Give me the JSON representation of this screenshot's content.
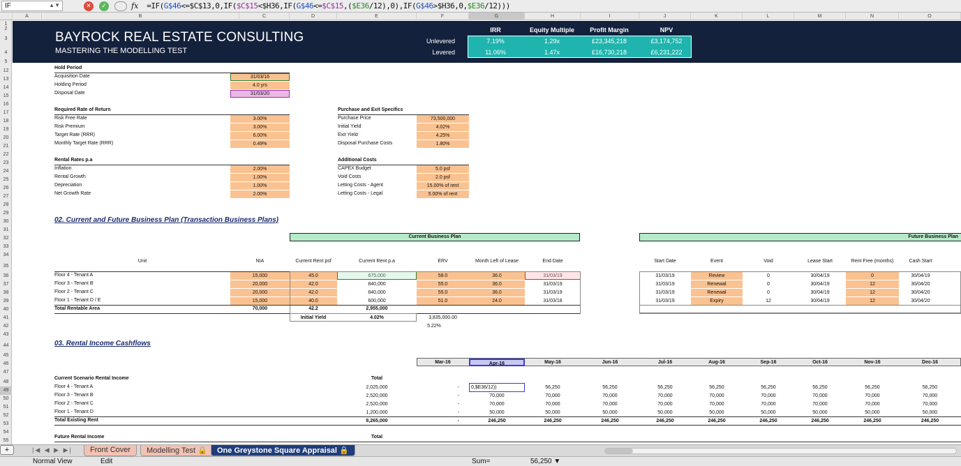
{
  "formula_bar": {
    "name_box": "IF",
    "formula_parts": [
      {
        "t": "=IF(",
        "c": ""
      },
      {
        "t": "G$46",
        "c": "blue"
      },
      {
        "t": "<=",
        "c": ""
      },
      {
        "t": "$C$13",
        "c": ""
      },
      {
        "t": ",0,IF(",
        "c": ""
      },
      {
        "t": "$C$15",
        "c": "purple"
      },
      {
        "t": "<",
        "c": ""
      },
      {
        "t": "$H36",
        "c": ""
      },
      {
        "t": ",IF(",
        "c": ""
      },
      {
        "t": "G$46",
        "c": "blue"
      },
      {
        "t": "<=",
        "c": ""
      },
      {
        "t": "$C$15",
        "c": "purple"
      },
      {
        "t": ",(",
        "c": ""
      },
      {
        "t": "$E36",
        "c": "green"
      },
      {
        "t": "/12),0),IF(",
        "c": ""
      },
      {
        "t": "G$46",
        "c": "blue"
      },
      {
        "t": ">",
        "c": ""
      },
      {
        "t": "$H36",
        "c": ""
      },
      {
        "t": ",0,",
        "c": ""
      },
      {
        "t": "$E36",
        "c": "green"
      },
      {
        "t": "/12)))",
        "c": ""
      }
    ]
  },
  "columns": [
    "A",
    "B",
    "C",
    "D",
    "E",
    "F",
    "G",
    "H",
    "I",
    "J",
    "K",
    "L",
    "M",
    "N",
    "O"
  ],
  "rows": [
    "1",
    "2",
    "3",
    "4",
    "5",
    "12",
    "13",
    "14",
    "15",
    "16",
    "17",
    "18",
    "19",
    "20",
    "21",
    "22",
    "23",
    "24",
    "25",
    "26",
    "27",
    "28",
    "29",
    "30",
    "31",
    "32",
    "33",
    "34",
    "35",
    "36",
    "37",
    "38",
    "39",
    "40",
    "41",
    "42",
    "43",
    "44",
    "45",
    "46",
    "47",
    "48",
    "49",
    "50",
    "51",
    "52",
    "53",
    "54",
    "55"
  ],
  "banner": {
    "title": "BAYROCK REAL ESTATE CONSULTING",
    "subtitle": "MASTERING THE MODELLING TEST",
    "metric_headers": [
      "IRR",
      "Equity Multiple",
      "Profit Margin",
      "NPV"
    ],
    "rows": [
      {
        "label": "Unlevered",
        "values": [
          "7.19%",
          "1.29x",
          "£23,345,218",
          "£3,174,752"
        ]
      },
      {
        "label": "Levered",
        "values": [
          "11.06%",
          "1.47x",
          "£16,730,218",
          "£6,231,222"
        ]
      }
    ]
  },
  "hold_period": {
    "header": "Hold Period",
    "items": [
      {
        "label": "Acquisition Date",
        "value": "31/03/16"
      },
      {
        "label": "Holding Period",
        "value": "4.0 yrs"
      },
      {
        "label": "Disposal Date",
        "value": "31/03/20"
      }
    ]
  },
  "required_return": {
    "header": "Required Rate of Return",
    "items": [
      {
        "label": "Risk Free Rate",
        "value": "3.00%"
      },
      {
        "label": "Risk Premium",
        "value": "3.00%"
      },
      {
        "label": "Target Rate (RRR)",
        "value": "6.00%"
      },
      {
        "label": "Monthly Target Rate (RRR)",
        "value": "0.49%"
      }
    ]
  },
  "rental_rates": {
    "header": "Rental Rates p.a",
    "items": [
      {
        "label": "Inflation",
        "value": "2.00%"
      },
      {
        "label": "Rental Growth",
        "value": "1.00%"
      },
      {
        "label": "Depreciation",
        "value": "1.00%"
      },
      {
        "label": "Net Growth Rate",
        "value": "2.00%"
      }
    ]
  },
  "purchase_exit": {
    "header": "Purchase and Exit Specifics",
    "items": [
      {
        "label": "Purchase Price",
        "value": "73,500,000"
      },
      {
        "label": "Initial Yield",
        "value": "4.02%"
      },
      {
        "label": "Exit Yield",
        "value": "4.25%"
      },
      {
        "label": "Disposal Purchase Costs",
        "value": "1.80%"
      }
    ]
  },
  "additional_costs": {
    "header": "Additional Costs",
    "items": [
      {
        "label": "CAPEX Budget",
        "value": "5.0 psf"
      },
      {
        "label": "Void Costs",
        "value": "2.0 psf"
      },
      {
        "label": "Letting Costs - Agent",
        "value": "15.00% of rent"
      },
      {
        "label": "Letting Costs - Legal",
        "value": "5.00% of rent"
      }
    ]
  },
  "section2": {
    "title": "02. Current and Future Business Plan (Transaction Business Plans)",
    "current_plan_label": "Current Business Plan",
    "future_plan_label": "Future Business Plan",
    "headers": [
      "Unit",
      "NIA",
      "Current Rent psf",
      "Current Rent p.a",
      "ERV",
      "Month Left of Lease",
      "End Date",
      "Start Date",
      "Event",
      "Void",
      "Lease Start",
      "Rent Free (months)",
      "Cash Start"
    ],
    "units": [
      {
        "unit": "Floor 4 - Tenant A",
        "nia": "15,000",
        "rent_psf": "45.0",
        "rent_pa": "675,000",
        "erv": "58.0",
        "months": "36.0",
        "end": "31/03/19",
        "start": "31/03/19",
        "event": "Review",
        "void": "0",
        "lease_start": "30/04/19",
        "rent_free": "0",
        "cash_start": "30/04/19"
      },
      {
        "unit": "Floor 3 - Tenant B",
        "nia": "20,000",
        "rent_psf": "42.0",
        "rent_pa": "840,000",
        "erv": "55.0",
        "months": "36.0",
        "end": "31/03/19",
        "start": "31/03/19",
        "event": "Renewal",
        "void": "0",
        "lease_start": "30/04/19",
        "rent_free": "12",
        "cash_start": "30/04/20"
      },
      {
        "unit": "Floor 2 - Tenant C",
        "nia": "20,000",
        "rent_psf": "42.0",
        "rent_pa": "840,000",
        "erv": "55.0",
        "months": "36.0",
        "end": "31/03/19",
        "start": "31/03/19",
        "event": "Renewal",
        "void": "0",
        "lease_start": "30/04/19",
        "rent_free": "12",
        "cash_start": "30/04/20"
      },
      {
        "unit": "Floor 1 - Tenant D / E",
        "nia": "15,000",
        "rent_psf": "40.0",
        "rent_pa": "600,000",
        "erv": "51.0",
        "months": "24.0",
        "end": "31/03/18",
        "start": "31/03/19",
        "event": "Expiry",
        "void": "12",
        "lease_start": "30/04/19",
        "rent_free": "12",
        "cash_start": "30/04/20"
      }
    ],
    "total": {
      "label": "Total Rentable Area",
      "nia": "70,000",
      "rent_psf": "42.2",
      "rent_pa": "2,955,000"
    },
    "initial_yield_label": "Initial Yield",
    "initial_yield_value": "4.02%",
    "erv_total": "3,835,000.00",
    "erv_yield": "5.22%"
  },
  "section3": {
    "title": "03. Rental Income Cashflows",
    "months": [
      "Mar-16",
      "Apr-16",
      "May-16",
      "Jun-16",
      "Jul-16",
      "Aug-16",
      "Sep-16",
      "Oct-16",
      "Nov-16",
      "Dec-16"
    ],
    "current_label": "Current Scenario Rental Income",
    "total_header": "Total",
    "edit_cell_text": "0,$E36/12))",
    "rows": [
      {
        "label": "Floor 4 - Tenant A",
        "total": "2,025,000",
        "vals": [
          "-",
          "",
          "56,250",
          "56,250",
          "56,250",
          "56,250",
          "56,250",
          "56,250",
          "56,250",
          "56,250"
        ]
      },
      {
        "label": "Floor 3 - Tenant B",
        "total": "2,520,000",
        "vals": [
          "-",
          "70,000",
          "70,000",
          "70,000",
          "70,000",
          "70,000",
          "70,000",
          "70,000",
          "70,000",
          "70,000"
        ]
      },
      {
        "label": "Floor 2 - Tenant C",
        "total": "2,520,000",
        "vals": [
          "-",
          "70,000",
          "70,000",
          "70,000",
          "70,000",
          "70,000",
          "70,000",
          "70,000",
          "70,000",
          "70,000"
        ]
      },
      {
        "label": "Floor 1 - Tenant D",
        "total": "1,200,000",
        "vals": [
          "-",
          "50,000",
          "50,000",
          "50,000",
          "50,000",
          "50,000",
          "50,000",
          "50,000",
          "50,000",
          "50,000"
        ]
      }
    ],
    "existing_total": {
      "label": "Total Existing Rent",
      "total": "8,265,000",
      "vals": [
        "-",
        "246,250",
        "246,250",
        "246,250",
        "246,250",
        "246,250",
        "246,250",
        "246,250",
        "246,250",
        "246,250"
      ]
    },
    "future_label": "Future Rental Income",
    "future_total_header": "Total"
  },
  "tabs": [
    {
      "label": "Front Cover"
    },
    {
      "label": "Modelling Test"
    },
    {
      "label": "One Greystone Square Appraisal"
    }
  ],
  "status": {
    "mode": "Normal View",
    "edit": "Edit",
    "sum_label": "Sum=",
    "sum_value": "56,250"
  },
  "colors": {
    "navy": "#14213d",
    "teal": "#1fb5ae",
    "input": "#f9c290",
    "green_header": "#b7eac9",
    "section_title": "#1a2b6d"
  }
}
